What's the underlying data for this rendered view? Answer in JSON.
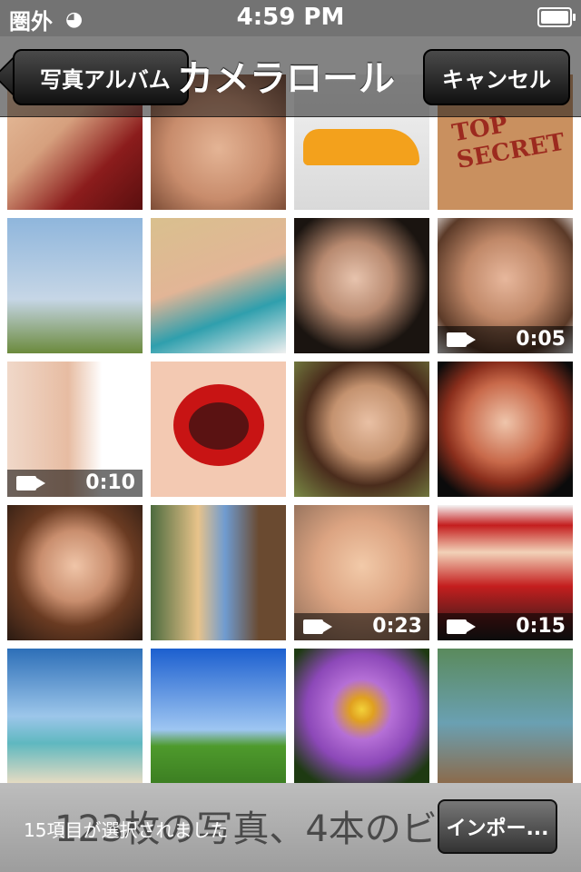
{
  "status": {
    "carrier": "圏外",
    "time": "4:59 PM"
  },
  "nav": {
    "back_label": "写真アルバム",
    "title": "カメラロール",
    "cancel_label": "キャンセル"
  },
  "bottom": {
    "ghost_text": "123枚の写真、4本のビ",
    "selected_label": "15項目が選択されました",
    "import_label": "インポー..."
  },
  "grid": {
    "rows": [
      [
        "woman-red-lingerie",
        "woman-face",
        "orange-sports-car",
        "top-secret-stamp"
      ],
      [
        "palm-trees",
        "woman-bed",
        "woman-portrait",
        "woman-green-eyes"
      ],
      [
        "woman-eyes-closeup",
        "red-lips",
        "woman-smiling",
        "woman-red-hair"
      ],
      [
        "girl-smiling",
        "woman-blonde-tree",
        "baby-face",
        "baby-santa"
      ],
      [
        "beach",
        "tree-field",
        "purple-flower",
        "woman-lake"
      ]
    ],
    "videos": [
      {
        "row": 1,
        "col": 3,
        "duration": "0:05"
      },
      {
        "row": 2,
        "col": 0,
        "duration": "0:10"
      },
      {
        "row": 3,
        "col": 2,
        "duration": "0:23"
      },
      {
        "row": 3,
        "col": 3,
        "duration": "0:15"
      }
    ]
  }
}
